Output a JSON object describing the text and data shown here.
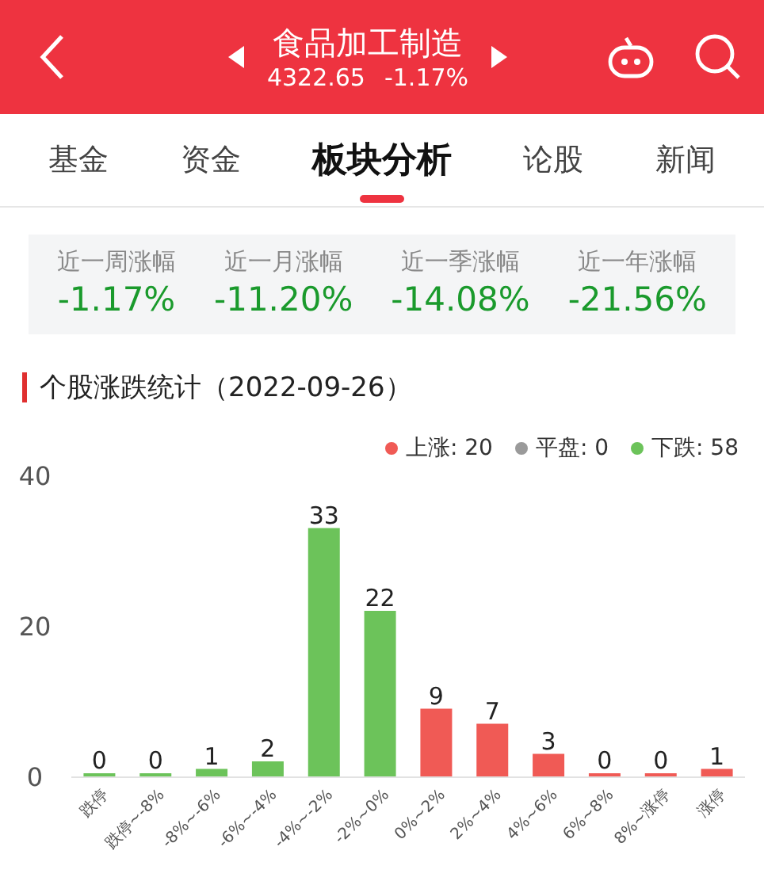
{
  "header": {
    "title": "食品加工制造",
    "price": "4322.65",
    "change": "-1.17%"
  },
  "tabs": [
    {
      "label": "基金",
      "selected": false
    },
    {
      "label": "资金",
      "selected": false
    },
    {
      "label": "板块分析",
      "selected": true
    },
    {
      "label": "论股",
      "selected": false
    },
    {
      "label": "新闻",
      "selected": false
    }
  ],
  "period_stats": [
    {
      "label": "近一周涨幅",
      "value": "-1.17%"
    },
    {
      "label": "近一月涨幅",
      "value": "-11.20%"
    },
    {
      "label": "近一季涨幅",
      "value": "-14.08%"
    },
    {
      "label": "近一年涨幅",
      "value": "-21.56%"
    }
  ],
  "section": {
    "title": "个股涨跌统计（2022-09-26）"
  },
  "legend": [
    {
      "label": "上涨: 20",
      "color": "#f05a55"
    },
    {
      "label": "平盘: 0",
      "color": "#9a9a9a"
    },
    {
      "label": "下跌: 58",
      "color": "#6cc35a"
    }
  ],
  "chart_data": {
    "type": "bar",
    "stacked": true,
    "data_labels": true,
    "ylim": [
      0,
      40
    ],
    "yticks": [
      0,
      20,
      40
    ],
    "categories": [
      "跌停",
      "跌停~-8%",
      "-8%~-6%",
      "-6%~-4%",
      "-4%~-2%",
      "-2%~0%",
      "0%~2%",
      "2%~4%",
      "4%~6%",
      "6%~8%",
      "8%~涨停",
      "涨停"
    ],
    "series": [
      {
        "color": "#6cc35a",
        "values": [
          0,
          0,
          1,
          2,
          33,
          22,
          null,
          null,
          null,
          null,
          null,
          null
        ]
      },
      {
        "color": "#f05a55",
        "values": [
          null,
          null,
          null,
          null,
          null,
          null,
          9,
          7,
          3,
          0,
          0,
          1
        ]
      }
    ]
  }
}
